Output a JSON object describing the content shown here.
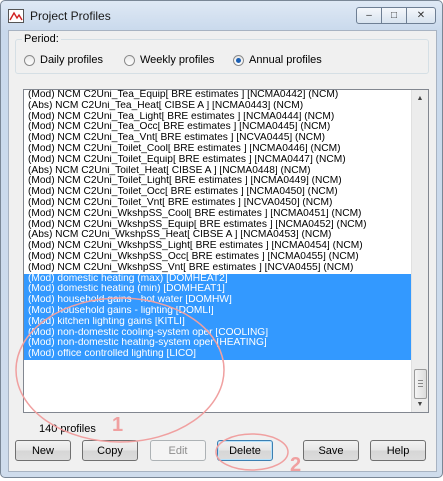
{
  "window": {
    "title": "Project Profiles",
    "controls": {
      "minimize": "–",
      "maximize": "□",
      "close": "✕"
    }
  },
  "period": {
    "legend": "Period:",
    "options": [
      {
        "label": "Daily profiles",
        "selected": false
      },
      {
        "label": "Weekly profiles",
        "selected": false
      },
      {
        "label": "Annual profiles",
        "selected": true
      }
    ]
  },
  "profiles": {
    "items": [
      {
        "text": "(Mod) NCM C2Uni_Tea_Equip[ BRE estimates ] [NCMA0442] (NCM)",
        "selected": false
      },
      {
        "text": "(Abs) NCM C2Uni_Tea_Heat[ CIBSE A ] [NCMA0443] (NCM)",
        "selected": false
      },
      {
        "text": "(Mod) NCM C2Uni_Tea_Light[ BRE estimates ] [NCMA0444] (NCM)",
        "selected": false
      },
      {
        "text": "(Mod) NCM C2Uni_Tea_Occ[ BRE estimates ] [NCMA0445] (NCM)",
        "selected": false
      },
      {
        "text": "(Mod) NCM C2Uni_Tea_Vnt[ BRE estimates ] [NCVA0445] (NCM)",
        "selected": false
      },
      {
        "text": "(Mod) NCM C2Uni_Toilet_Cool[ BRE estimates ] [NCMA0446] (NCM)",
        "selected": false
      },
      {
        "text": "(Mod) NCM C2Uni_Toilet_Equip[ BRE estimates ] [NCMA0447] (NCM)",
        "selected": false
      },
      {
        "text": "(Abs) NCM C2Uni_Toilet_Heat[ CIBSE A ] [NCMA0448] (NCM)",
        "selected": false
      },
      {
        "text": "(Mod) NCM C2Uni_Toilet_Light[ BRE estimates ] [NCMA0449] (NCM)",
        "selected": false
      },
      {
        "text": "(Mod) NCM C2Uni_Toilet_Occ[ BRE estimates ] [NCMA0450] (NCM)",
        "selected": false
      },
      {
        "text": "(Mod) NCM C2Uni_Toilet_Vnt[ BRE estimates ] [NCVA0450] (NCM)",
        "selected": false
      },
      {
        "text": "(Mod) NCM C2Uni_WkshpSS_Cool[ BRE estimates ] [NCMA0451] (NCM)",
        "selected": false
      },
      {
        "text": "(Mod) NCM C2Uni_WkshpSS_Equip[ BRE estimates ] [NCMA0452] (NCM)",
        "selected": false
      },
      {
        "text": "(Abs) NCM C2Uni_WkshpSS_Heat[ CIBSE A ] [NCMA0453] (NCM)",
        "selected": false
      },
      {
        "text": "(Mod) NCM C2Uni_WkshpSS_Light[ BRE estimates ] [NCMA0454] (NCM)",
        "selected": false
      },
      {
        "text": "(Mod) NCM C2Uni_WkshpSS_Occ[ BRE estimates ] [NCMA0455] (NCM)",
        "selected": false
      },
      {
        "text": "(Mod) NCM C2Uni_WkshpSS_Vnt[ BRE estimates ] [NCVA0455] (NCM)",
        "selected": false
      },
      {
        "text": "(Mod) domestic heating (max) [DOMHEAT2]",
        "selected": true
      },
      {
        "text": "(Mod) domestic heating (min) [DOMHEAT1]",
        "selected": true
      },
      {
        "text": "(Mod) household gains - hot water [DOMHW]",
        "selected": true
      },
      {
        "text": "(Mod) household gains - lighting [DOMLI]",
        "selected": true
      },
      {
        "text": "(Mod) kitchen lighting gains [KITLI]",
        "selected": true
      },
      {
        "text": "(Mod) non-domestic cooling-system oper [COOLING]",
        "selected": true
      },
      {
        "text": "(Mod) non-domestic heating-system oper [HEATING]",
        "selected": true
      },
      {
        "text": "(Mod) office controlled lighting [LICO]",
        "selected": true
      }
    ],
    "count_text": "140  profiles"
  },
  "buttons": {
    "new": "New",
    "copy": "Copy",
    "edit": "Edit",
    "delete": "Delete",
    "save": "Save",
    "help": "Help"
  },
  "callouts": {
    "one": "1",
    "two": "2"
  },
  "colors": {
    "selection": "#3399ff",
    "callout": "#f0a0a0"
  }
}
